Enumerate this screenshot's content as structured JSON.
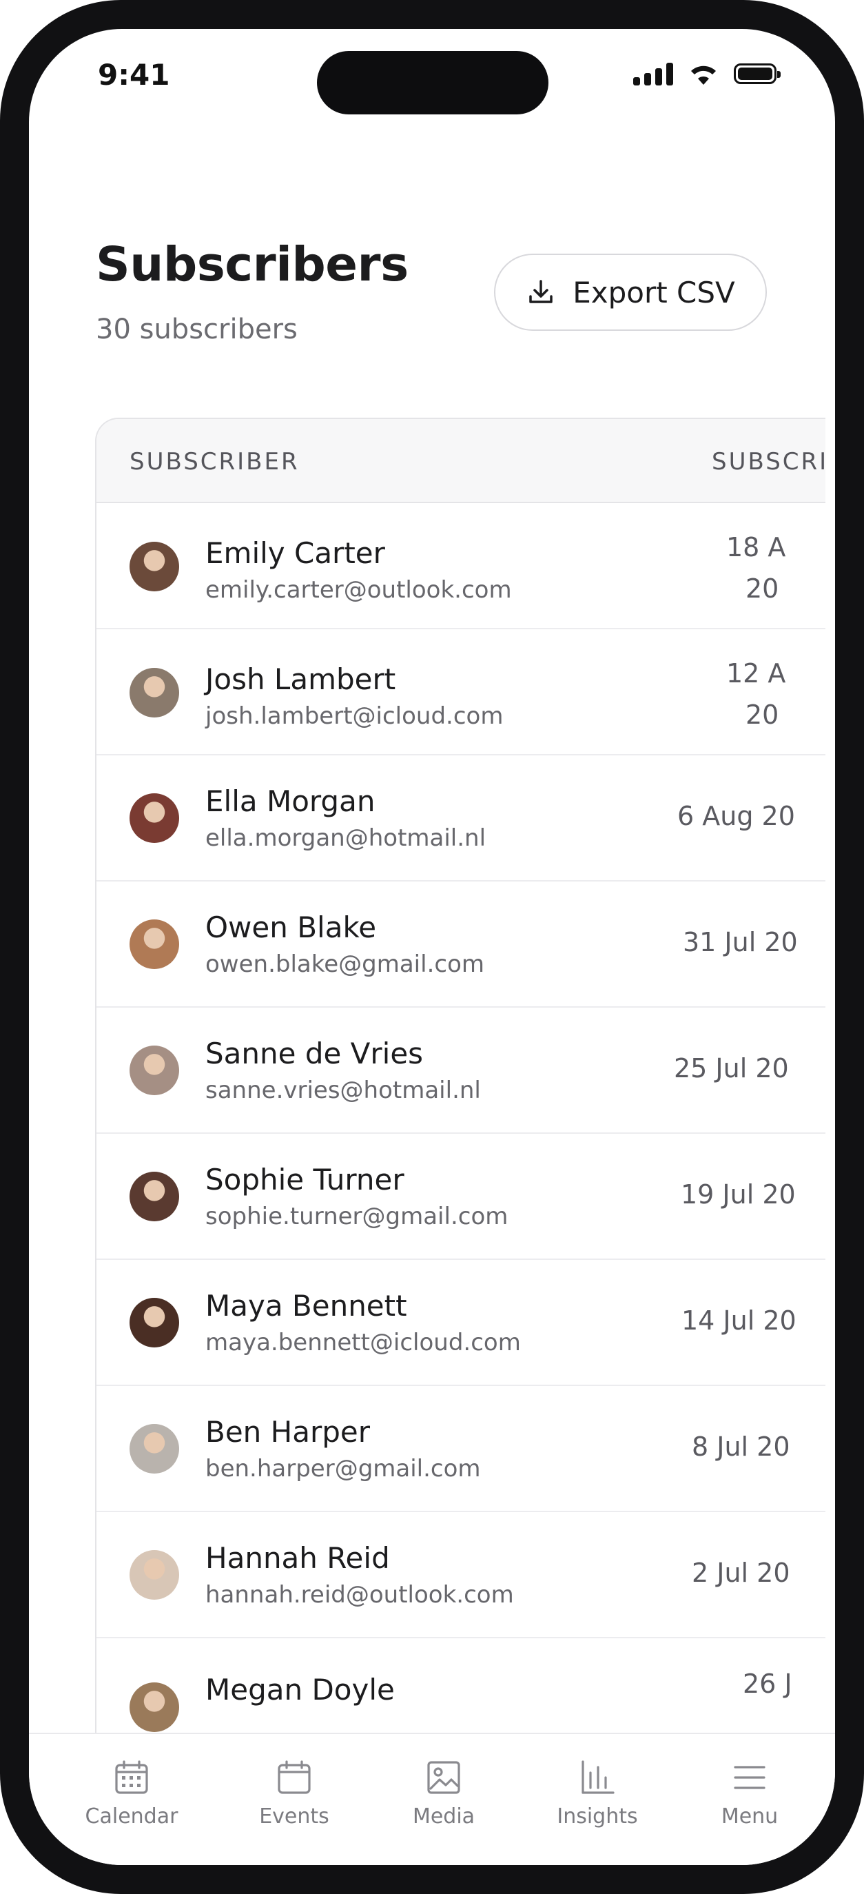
{
  "status_bar": {
    "time": "9:41"
  },
  "header": {
    "title": "Subscribers",
    "count_label": "30 subscribers",
    "export_button": {
      "label": "Export CSV",
      "icon": "download-icon"
    }
  },
  "table": {
    "columns": [
      "SUBSCRIBER",
      "SUBSCRIB"
    ],
    "rows": [
      {
        "name": "Emily Carter",
        "email": "emily.carter@outlook.com",
        "date_line1": "18 A",
        "date_line2": "20",
        "avatar_color": "#6b4a3a"
      },
      {
        "name": "Josh Lambert",
        "email": "josh.lambert@icloud.com",
        "date_line1": "12 A",
        "date_line2": "20",
        "avatar_color": "#8a7a6c"
      },
      {
        "name": "Ella Morgan",
        "email": "ella.morgan@hotmail.nl",
        "date_line1": "6 Aug 20",
        "date_line2": "",
        "avatar_color": "#7a3b32"
      },
      {
        "name": "Owen Blake",
        "email": "owen.blake@gmail.com",
        "date_line1": "31 Jul 20",
        "date_line2": "",
        "avatar_color": "#b07a55"
      },
      {
        "name": "Sanne de Vries",
        "email": "sanne.vries@hotmail.nl",
        "date_line1": "25 Jul 20",
        "date_line2": "",
        "avatar_color": "#a58f84"
      },
      {
        "name": "Sophie Turner",
        "email": "sophie.turner@gmail.com",
        "date_line1": "19 Jul 20",
        "date_line2": "",
        "avatar_color": "#5a3a30"
      },
      {
        "name": "Maya Bennett",
        "email": "maya.bennett@icloud.com",
        "date_line1": "14 Jul 20",
        "date_line2": "",
        "avatar_color": "#4a2e24"
      },
      {
        "name": "Ben Harper",
        "email": "ben.harper@gmail.com",
        "date_line1": "8 Jul 20",
        "date_line2": "",
        "avatar_color": "#b9b3ad"
      },
      {
        "name": "Hannah Reid",
        "email": "hannah.reid@outlook.com",
        "date_line1": "2 Jul 20",
        "date_line2": "",
        "avatar_color": "#d8c6b6"
      },
      {
        "name": "Megan Doyle",
        "email": "",
        "date_line1": "26 J",
        "date_line2": "",
        "avatar_color": "#9a7a5a"
      }
    ]
  },
  "tabbar": {
    "items": [
      {
        "label": "Calendar",
        "icon": "calendar-icon"
      },
      {
        "label": "Events",
        "icon": "events-icon"
      },
      {
        "label": "Media",
        "icon": "media-icon"
      },
      {
        "label": "Insights",
        "icon": "insights-icon"
      },
      {
        "label": "Menu",
        "icon": "menu-icon"
      }
    ]
  },
  "colors": {
    "text_primary": "#1c1c1e",
    "text_secondary": "#6b6b70",
    "border": "#e4e4e7",
    "header_bg": "#f7f7f8"
  }
}
